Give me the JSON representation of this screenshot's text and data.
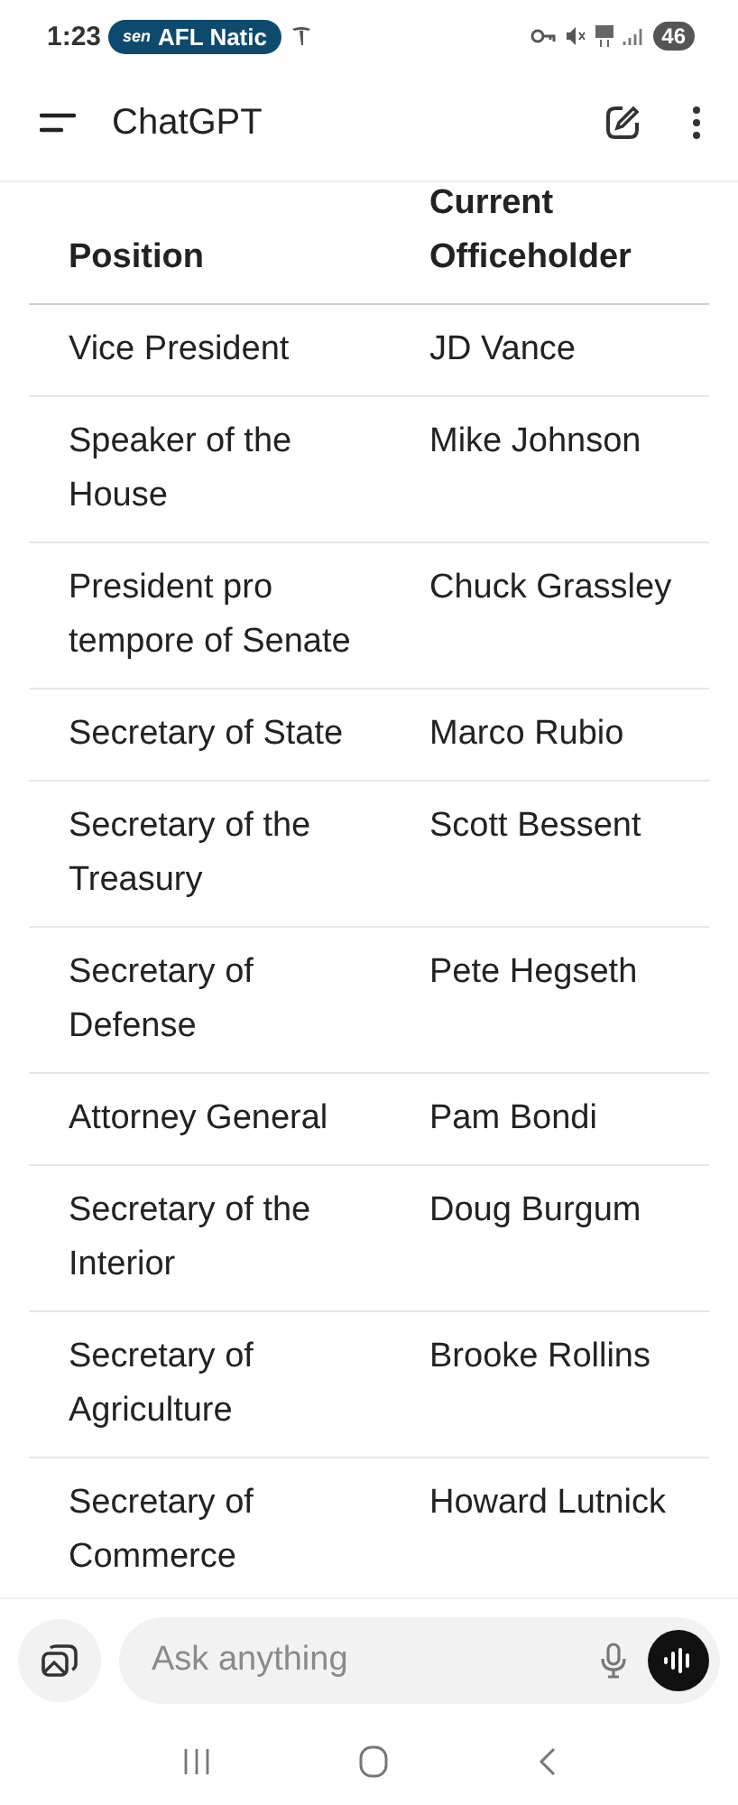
{
  "status_bar": {
    "time": "1:23",
    "notification": {
      "logo": "sen",
      "text": "AFL Natic"
    },
    "battery": "46"
  },
  "app_bar": {
    "title": "ChatGPT"
  },
  "table": {
    "columns": [
      "Position",
      "Current Officeholder"
    ],
    "rows": [
      [
        "Vice President",
        "JD Vance"
      ],
      [
        "Speaker of the House",
        "Mike Johnson"
      ],
      [
        "President pro tempore of Senate",
        "Chuck Grassley"
      ],
      [
        "Secretary of State",
        "Marco Rubio"
      ],
      [
        "Secretary of the Treasury",
        "Scott Bessent"
      ],
      [
        "Secretary of Defense",
        "Pete Hegseth"
      ],
      [
        "Attorney General",
        "Pam Bondi"
      ],
      [
        "Secretary of the Interior",
        "Doug Burgum"
      ],
      [
        "Secretary of Agriculture",
        "Brooke Rollins"
      ],
      [
        "Secretary of Commerce",
        "Howard Lutnick"
      ]
    ]
  },
  "composer": {
    "placeholder": "Ask anything"
  }
}
